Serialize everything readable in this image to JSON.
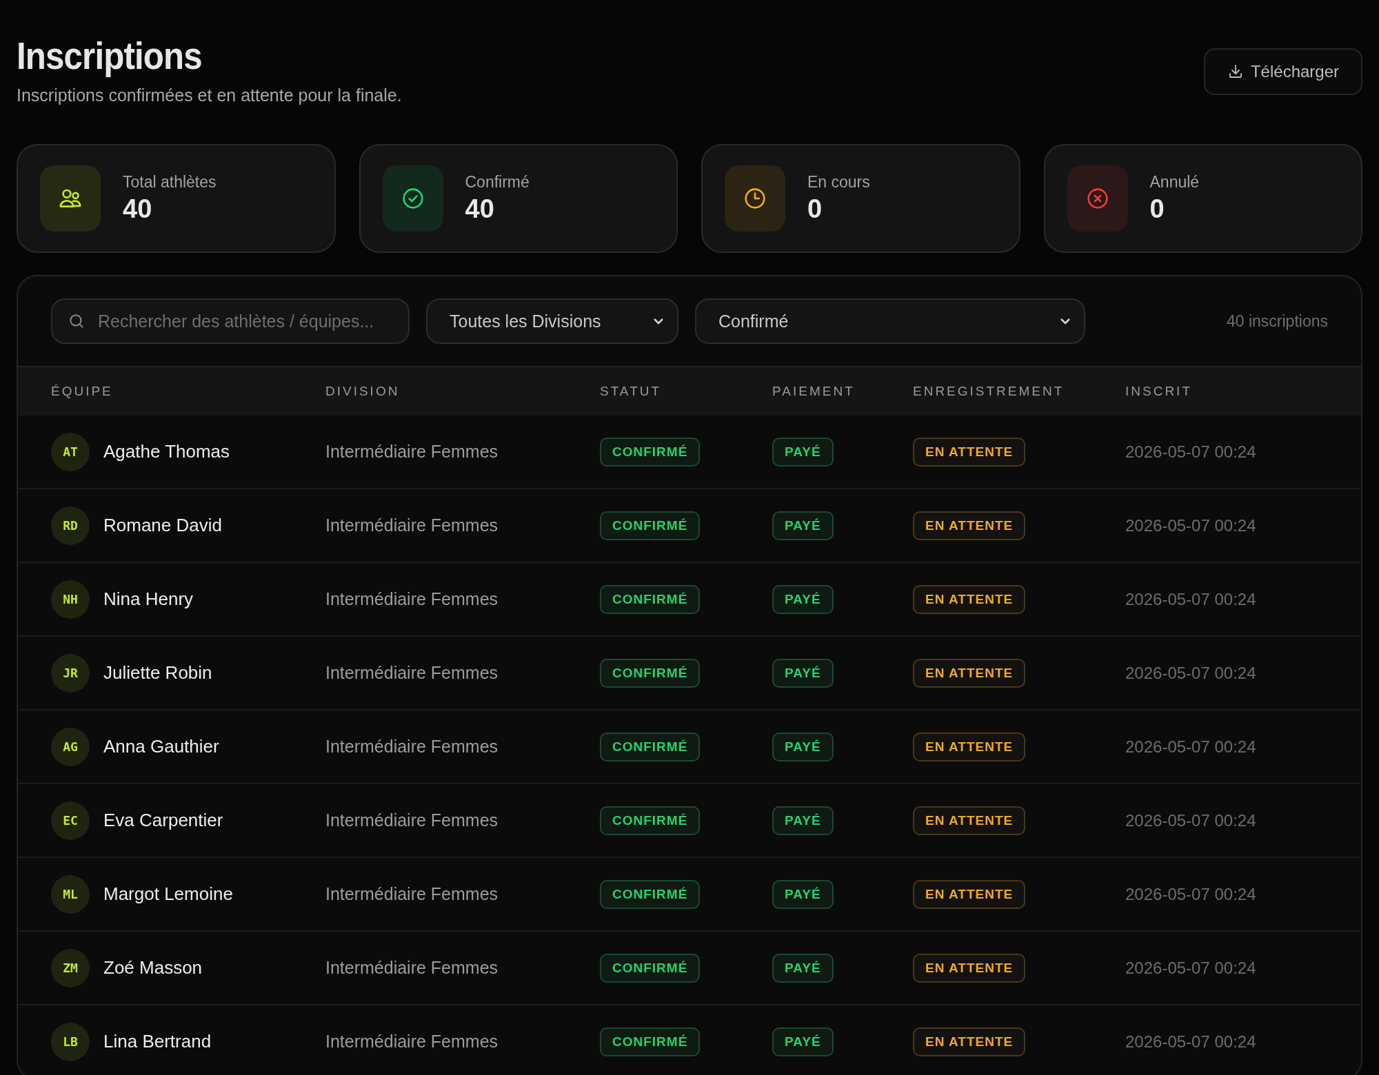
{
  "header": {
    "title": "Inscriptions",
    "subtitle": "Inscriptions confirmées et en attente pour la finale.",
    "download_button": "Télécharger"
  },
  "stats": [
    {
      "kind": "total",
      "label": "Total athlètes",
      "value": "40"
    },
    {
      "kind": "confirmed",
      "label": "Confirmé",
      "value": "40"
    },
    {
      "kind": "pending",
      "label": "En cours",
      "value": "0"
    },
    {
      "kind": "cancelled",
      "label": "Annulé",
      "value": "0"
    }
  ],
  "filters": {
    "search_placeholder": "Rechercher des athlètes / équipes...",
    "division": "Toutes les Divisions",
    "status": "Confirmé",
    "count": "40 inscriptions"
  },
  "table": {
    "columns": [
      "ÉQUIPE",
      "DIVISION",
      "STATUT",
      "PAIEMENT",
      "ENREGISTREMENT",
      "INSCRIT"
    ],
    "rows": [
      {
        "initials": "AT",
        "name": "Agathe Thomas",
        "division": "Intermédiaire Femmes",
        "status": {
          "kind": "success",
          "label": "CONFIRMÉ"
        },
        "payment": {
          "kind": "success",
          "label": "PAYÉ"
        },
        "checkin": {
          "kind": "warning",
          "label": "EN ATTENTE"
        },
        "registered": "2026-05-07 00:24"
      },
      {
        "initials": "RD",
        "name": "Romane David",
        "division": "Intermédiaire Femmes",
        "status": {
          "kind": "success",
          "label": "CONFIRMÉ"
        },
        "payment": {
          "kind": "success",
          "label": "PAYÉ"
        },
        "checkin": {
          "kind": "warning",
          "label": "EN ATTENTE"
        },
        "registered": "2026-05-07 00:24"
      },
      {
        "initials": "NH",
        "name": "Nina Henry",
        "division": "Intermédiaire Femmes",
        "status": {
          "kind": "success",
          "label": "CONFIRMÉ"
        },
        "payment": {
          "kind": "success",
          "label": "PAYÉ"
        },
        "checkin": {
          "kind": "warning",
          "label": "EN ATTENTE"
        },
        "registered": "2026-05-07 00:24"
      },
      {
        "initials": "JR",
        "name": "Juliette Robin",
        "division": "Intermédiaire Femmes",
        "status": {
          "kind": "success",
          "label": "CONFIRMÉ"
        },
        "payment": {
          "kind": "success",
          "label": "PAYÉ"
        },
        "checkin": {
          "kind": "warning",
          "label": "EN ATTENTE"
        },
        "registered": "2026-05-07 00:24"
      },
      {
        "initials": "AG",
        "name": "Anna Gauthier",
        "division": "Intermédiaire Femmes",
        "status": {
          "kind": "success",
          "label": "CONFIRMÉ"
        },
        "payment": {
          "kind": "success",
          "label": "PAYÉ"
        },
        "checkin": {
          "kind": "warning",
          "label": "EN ATTENTE"
        },
        "registered": "2026-05-07 00:24"
      },
      {
        "initials": "EC",
        "name": "Eva Carpentier",
        "division": "Intermédiaire Femmes",
        "status": {
          "kind": "success",
          "label": "CONFIRMÉ"
        },
        "payment": {
          "kind": "success",
          "label": "PAYÉ"
        },
        "checkin": {
          "kind": "warning",
          "label": "EN ATTENTE"
        },
        "registered": "2026-05-07 00:24"
      },
      {
        "initials": "ML",
        "name": "Margot Lemoine",
        "division": "Intermédiaire Femmes",
        "status": {
          "kind": "success",
          "label": "CONFIRMÉ"
        },
        "payment": {
          "kind": "success",
          "label": "PAYÉ"
        },
        "checkin": {
          "kind": "warning",
          "label": "EN ATTENTE"
        },
        "registered": "2026-05-07 00:24"
      },
      {
        "initials": "ZM",
        "name": "Zoé Masson",
        "division": "Intermédiaire Femmes",
        "status": {
          "kind": "success",
          "label": "CONFIRMÉ"
        },
        "payment": {
          "kind": "success",
          "label": "PAYÉ"
        },
        "checkin": {
          "kind": "warning",
          "label": "EN ATTENTE"
        },
        "registered": "2026-05-07 00:24"
      },
      {
        "initials": "LB",
        "name": "Lina Bertrand",
        "division": "Intermédiaire Femmes",
        "status": {
          "kind": "success",
          "label": "CONFIRMÉ"
        },
        "payment": {
          "kind": "success",
          "label": "PAYÉ"
        },
        "checkin": {
          "kind": "warning",
          "label": "EN ATTENTE"
        },
        "registered": "2026-05-07 00:24"
      }
    ]
  }
}
